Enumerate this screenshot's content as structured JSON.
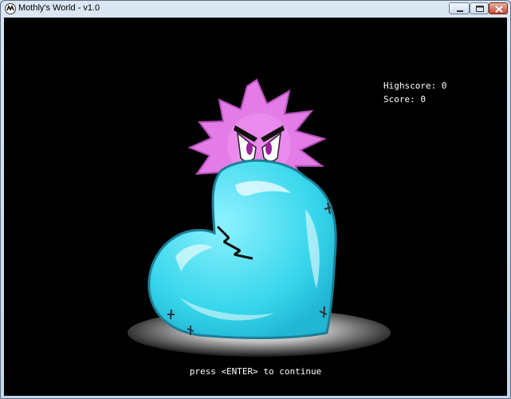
{
  "window": {
    "title": "Mothly's World - v1.0",
    "buttons": {
      "minimize": "minimize-icon",
      "maximize": "maximize-icon",
      "close": "close-icon"
    }
  },
  "hud": {
    "highscore_label": "Highscore:",
    "highscore": 0,
    "score_label": "Score:",
    "score": 0
  },
  "prompt": "press <ENTER> to continue",
  "colors": {
    "background": "#000000",
    "creature": "#e37ce6",
    "heart": "#3fd8ec",
    "text": "#ffffff"
  }
}
